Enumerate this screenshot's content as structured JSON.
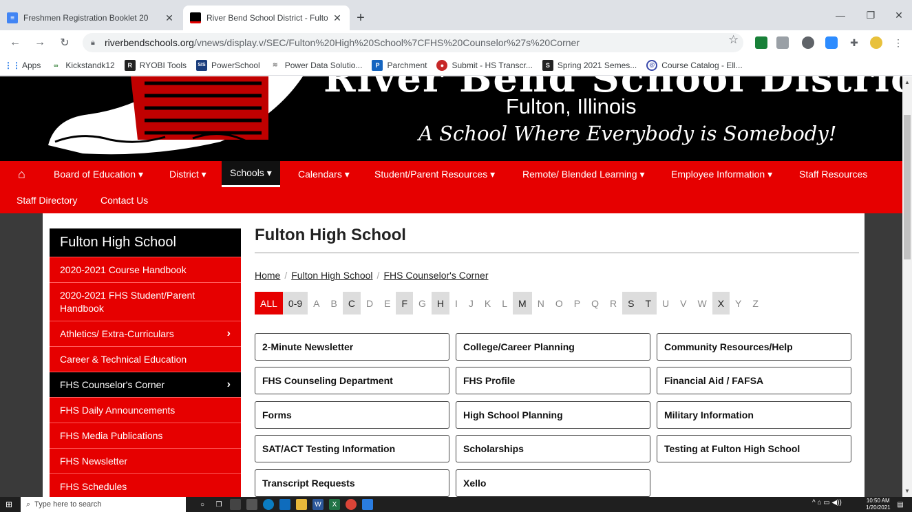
{
  "browser": {
    "tabs": [
      {
        "title": "Freshmen Registration Booklet 20",
        "active": false
      },
      {
        "title": "River Bend School District - Fulto",
        "active": true
      }
    ],
    "new_tab": "+",
    "url_domain": "riverbendschools.org",
    "url_path": "/vnews/display.v/SEC/Fulton%20High%20School%7CFHS%20Counselor%27s%20Corner",
    "bookmarks": [
      "Apps",
      "Kickstandk12",
      "RYOBI Tools",
      "PowerSchool",
      "Power Data Solutio...",
      "Parchment",
      "Submit - HS Transcr...",
      "Spring 2021 Semes...",
      "Course Catalog - Ell..."
    ]
  },
  "banner": {
    "district": "River Bend School District",
    "city": "Fulton, Illinois",
    "motto": "A School Where Everybody is Somebody!"
  },
  "nav": {
    "row1": [
      "Board of Education ▾",
      "District ▾",
      "Schools ▾",
      "Calendars ▾",
      "Student/Parent Resources ▾",
      "Remote/ Blended Learning ▾",
      "Employee Information ▾",
      "Staff Resources"
    ],
    "row2": [
      "Staff Directory",
      "Contact Us"
    ]
  },
  "sidebar": {
    "title": "Fulton High School",
    "items": [
      "2020-2021 Course Handbook",
      "2020-2021 FHS Student/Parent Handbook",
      "Athletics/ Extra-Curriculars",
      "Career & Technical Education",
      "FHS Counselor's Corner",
      "FHS Daily Announcements",
      "FHS Media Publications",
      "FHS Newsletter",
      "FHS Schedules"
    ]
  },
  "main": {
    "title": "Fulton High School",
    "breadcrumbs": [
      "Home",
      "Fulton High School",
      "FHS Counselor's Corner"
    ],
    "letters": [
      "ALL",
      "0-9",
      "A",
      "B",
      "C",
      "D",
      "E",
      "F",
      "G",
      "H",
      "I",
      "J",
      "K",
      "L",
      "M",
      "N",
      "O",
      "P",
      "Q",
      "R",
      "S",
      "T",
      "U",
      "V",
      "W",
      "X",
      "Y",
      "Z"
    ],
    "links": [
      "2-Minute Newsletter",
      "College/Career Planning",
      "Community Resources/Help",
      "FHS Counseling Department",
      "FHS Profile",
      "Financial Aid / FAFSA",
      "Forms",
      "High School Planning",
      "Military Information",
      "SAT/ACT Testing Information",
      "Scholarships",
      "Testing at Fulton High School",
      "Transcript Requests",
      "Xello"
    ]
  },
  "taskbar": {
    "search_placeholder": "Type here to search",
    "time": "10:50 AM",
    "date": "1/20/2021"
  }
}
